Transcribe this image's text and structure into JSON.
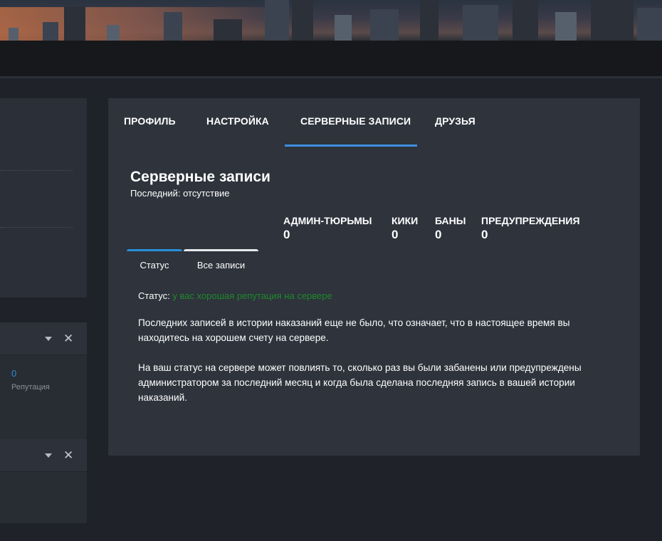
{
  "colors": {
    "background": "#1f2229",
    "card": "#2e333c",
    "accent": "#3d8fe0",
    "status_good": "#1f8a2b",
    "link_blue": "#2f8fd8"
  },
  "tabs": [
    {
      "label": "ПРОФИЛЬ",
      "active": false
    },
    {
      "label": "НАСТРОЙКА",
      "active": false
    },
    {
      "label": "СЕРВЕРНЫЕ ЗАПИСИ",
      "active": true
    },
    {
      "label": "ДРУЗЬЯ",
      "active": false
    }
  ],
  "section": {
    "title": "Серверные записи",
    "subtitle": "Последний: отсутствие"
  },
  "stats": [
    {
      "label": "АДМИН-ТЮРЬМЫ",
      "value": "0"
    },
    {
      "label": "КИКИ",
      "value": "0"
    },
    {
      "label": "БАНЫ",
      "value": "0"
    },
    {
      "label": "ПРЕДУПРЕЖДЕНИЯ",
      "value": "0"
    }
  ],
  "subtabs": [
    {
      "label": "Статус",
      "active": true
    },
    {
      "label": "Все записи",
      "active": false
    }
  ],
  "status": {
    "label": "Статус:",
    "value": "у вас хорошая репутация на сервере"
  },
  "paragraphs": [
    "Последних записей в истории наказаний еще не было, что означает, что в настоящее время вы находитесь на хорошем счету на сервере.",
    "На ваш статус на сервере может повлиять то, сколько раз вы были забанены или предупреждены администратором за последний месяц и когда была сделана последняя запись в вашей истории наказаний."
  ],
  "sidebar": {
    "reputation_value": "0",
    "reputation_label": "Репутация",
    "close_glyph": "✕"
  },
  "icons": {
    "caret": "chevron-down-icon",
    "close": "close-icon"
  }
}
